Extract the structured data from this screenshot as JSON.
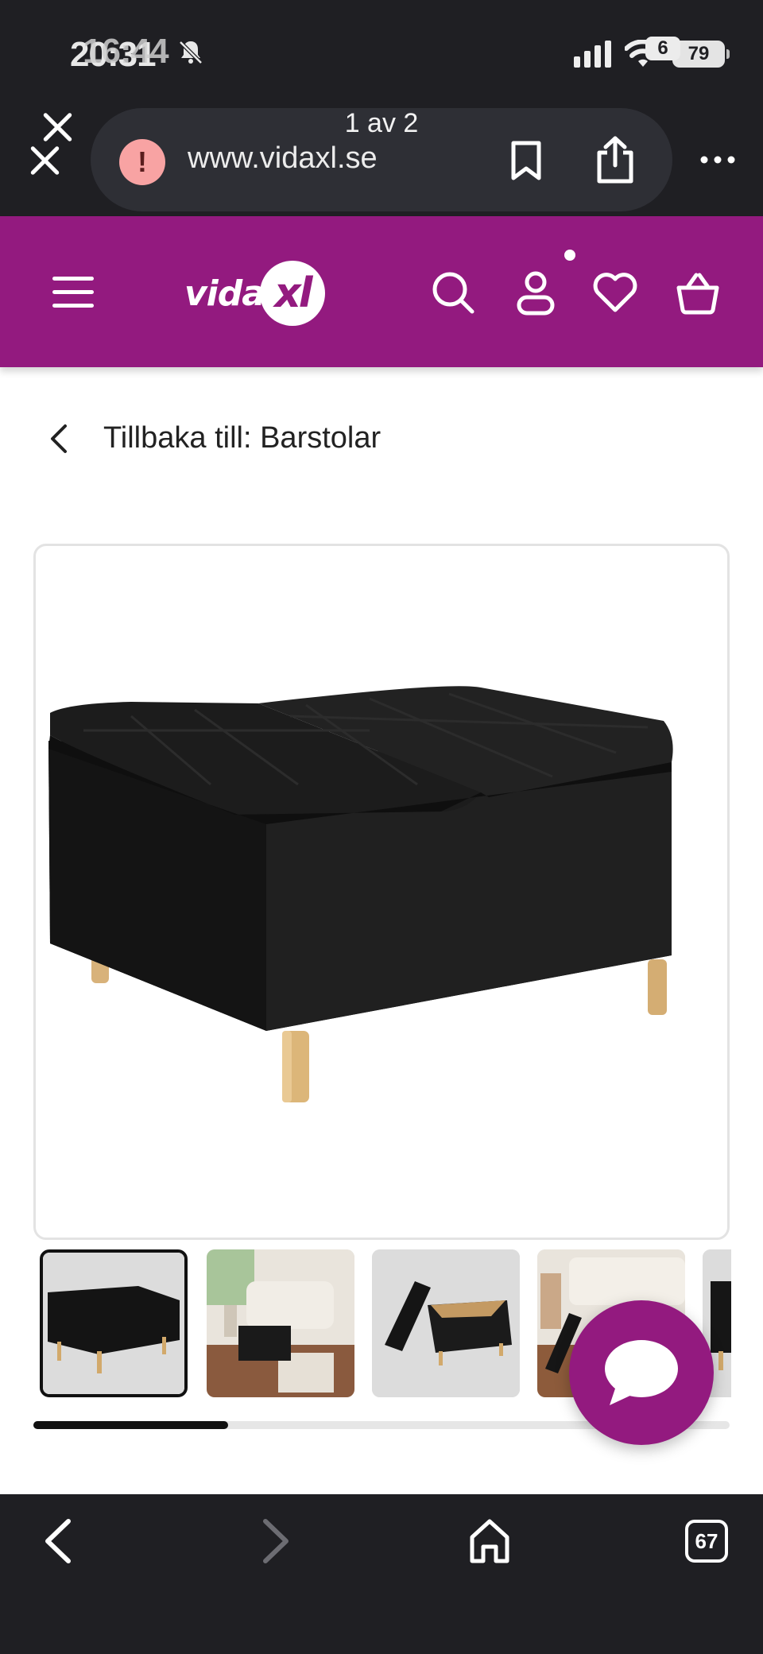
{
  "status_bar": {
    "time": "20:31",
    "time_overlay": "16:44",
    "battery_level": "79",
    "battery_overlay": "6"
  },
  "browser": {
    "page_counter": "1 av 2",
    "url": "www.vidaxl.se",
    "security_icon_glyph": "!",
    "tab_count": "67"
  },
  "site": {
    "brand_color": "#931a7f",
    "logo_text": "vida",
    "logo_badge": "xl",
    "icons": [
      "menu-icon",
      "search-icon",
      "account-icon",
      "wishlist-heart-icon",
      "cart-basket-icon"
    ]
  },
  "breadcrumb": {
    "back_label": "Tillbaka till: Barstolar"
  },
  "gallery": {
    "main_image": "black tufted storage ottoman with wooden legs",
    "thumbnails": [
      "ottoman-product-shot",
      "ottoman-in-living-room",
      "ottoman-open-storage",
      "ottoman-lid-open-room",
      "ottoman-partial"
    ],
    "active_index": 0,
    "scroll_progress": 0.28
  },
  "chat": {
    "icon": "chat-bubble-icon"
  }
}
